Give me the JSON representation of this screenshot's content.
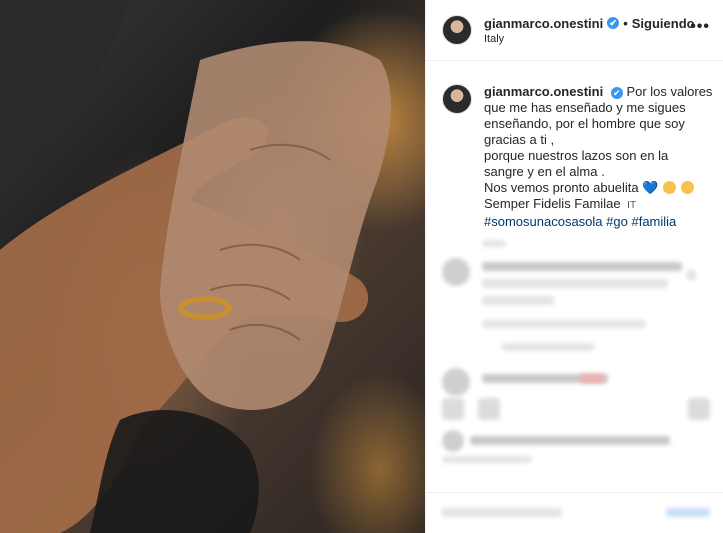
{
  "post": {
    "username": "gianmarco.onestini",
    "verified_glyph": "✔",
    "follow_status": "Siguiendo",
    "location": "Italy",
    "separator": "•",
    "more_glyph": "•••"
  },
  "caption": {
    "username": "gianmarco.onestini",
    "lines": [
      "Por los valores",
      "que me has enseñado y me sigues",
      "enseñando, por el hombre que soy",
      "gracias a ti ,",
      "porque nuestros lazos son en la",
      "sangre y en el alma .",
      "Nos vemos pronto abuelita",
      "Semper Fidelis Familae",
      "#somosunacosasola",
      "#go",
      "#familia"
    ],
    "heart_glyph": "💙",
    "flag_text": "IT"
  },
  "colors": {
    "verified_blue": "#3897f0",
    "hashtag_blue": "#00376b",
    "heart_blue": "#3d8be8",
    "emoji_yellow": "#f7c24a"
  }
}
